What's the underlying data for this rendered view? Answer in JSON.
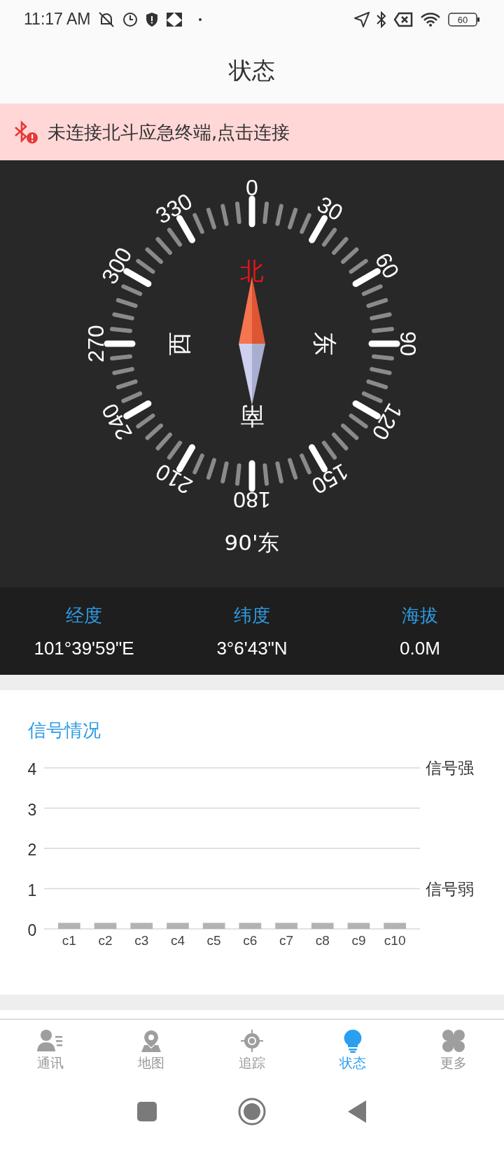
{
  "status_bar": {
    "time": "11:17 AM",
    "battery": "60"
  },
  "header": {
    "title": "状态"
  },
  "banner": {
    "text": "未连接北斗应急终端,点击连接"
  },
  "compass": {
    "dial_labels": [
      "0",
      "30",
      "60",
      "90",
      "120",
      "150",
      "180",
      "210",
      "240",
      "270",
      "300",
      "330"
    ],
    "directions": [
      {
        "label": "北",
        "selected": true
      },
      {
        "label": "东",
        "selected": false
      },
      {
        "label": "南",
        "selected": false
      },
      {
        "label": "西",
        "selected": false
      }
    ],
    "heading": "90'东"
  },
  "location": [
    {
      "label": "经度",
      "value": "101°39'59\"E"
    },
    {
      "label": "纬度",
      "value": "3°6'43\"N"
    },
    {
      "label": "海拔",
      "value": "0.0M"
    }
  ],
  "signal": {
    "title": "信号情况",
    "chart_data": {
      "type": "bar",
      "categories": [
        "c1",
        "c2",
        "c3",
        "c4",
        "c5",
        "c6",
        "c7",
        "c8",
        "c9",
        "c10"
      ],
      "values": [
        0.15,
        0.15,
        0.15,
        0.15,
        0.15,
        0.15,
        0.15,
        0.15,
        0.15,
        0.15
      ],
      "ylim": [
        0,
        4
      ],
      "yticks": [
        0,
        1,
        2,
        3,
        4
      ],
      "grid": true,
      "annotations": [
        "信号强",
        "信号弱"
      ]
    }
  },
  "tab_bar": [
    {
      "label": "通讯",
      "selected": false
    },
    {
      "label": "地图",
      "selected": false
    },
    {
      "label": "追踪",
      "selected": false
    },
    {
      "label": "状态",
      "selected": true
    },
    {
      "label": "更多",
      "selected": false
    }
  ]
}
